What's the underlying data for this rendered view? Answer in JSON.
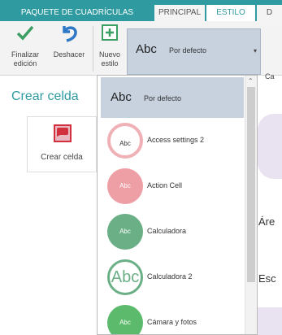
{
  "tabs": [
    {
      "label": "PAQUETE DE CUADRÍCULAS"
    },
    {
      "label": "PRINCIPAL"
    },
    {
      "label": "ESTILO"
    },
    {
      "label": "D"
    }
  ],
  "ribbon": {
    "finish_label": "Finalizar edición",
    "undo_label": "Deshacer",
    "new_style_label": "Nuevo estilo",
    "style_abc": "Abc",
    "style_current": "Por defecto",
    "partial_right": "Ca"
  },
  "left_panel": {
    "title": "Crear celda",
    "card_label": "Crear celda"
  },
  "background": {
    "text_area": "Áre",
    "text_esc": "Esc"
  },
  "dropdown": {
    "selected": {
      "abc": "Abc",
      "label": "Por defecto"
    },
    "items": [
      {
        "abc": "Abc",
        "label": "Access settings 2"
      },
      {
        "abc": "Abc",
        "label": "Action Cell"
      },
      {
        "abc": "Abc",
        "label": "Calculadora"
      },
      {
        "abc": "Abc",
        "label": "Calculadora 2"
      },
      {
        "abc": "Abc",
        "label": "Cámara y fotos"
      }
    ]
  },
  "colors": {
    "accent": "#2f9ba1",
    "selected_bg": "#c8d2df"
  }
}
